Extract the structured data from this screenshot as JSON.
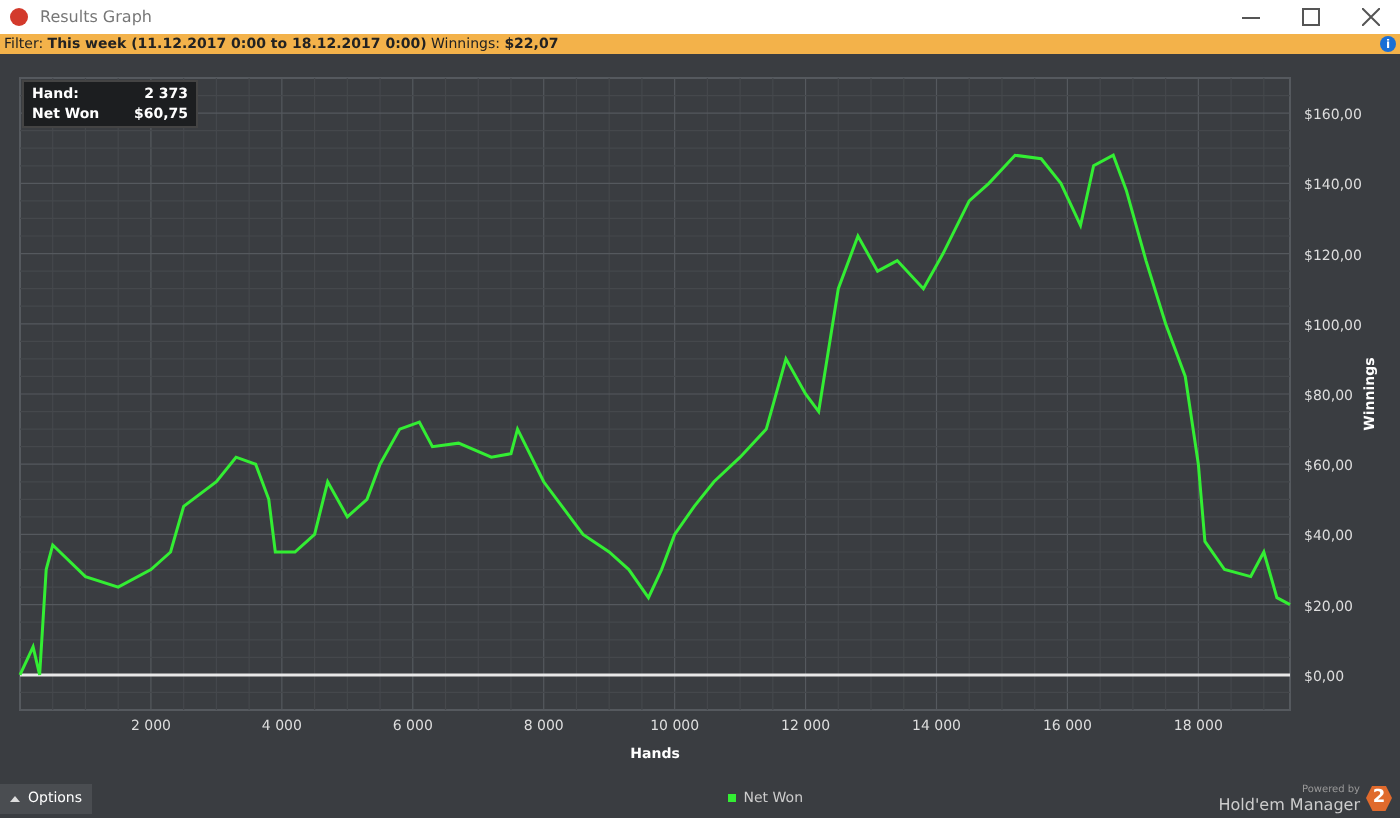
{
  "window": {
    "title": "Results Graph"
  },
  "filter_bar": {
    "text": "Filter: **This week (11.12.2017 0:00 to 18.12.2017 0:00)** Winnings: **$22,07**",
    "info": "i"
  },
  "hover_info": [
    {
      "label": "Hand:",
      "value": "2 373"
    },
    {
      "label": "Net Won",
      "value": "$60,75"
    }
  ],
  "chart_data": {
    "type": "line",
    "grid": true,
    "xlabel": "Hands",
    "ylabel": "Winnings",
    "xlim": [
      0,
      19400
    ],
    "ylim": [
      -10,
      170
    ],
    "xticks": [
      {
        "value": 2000,
        "label": "2 000"
      },
      {
        "value": 4000,
        "label": "4 000"
      },
      {
        "value": 6000,
        "label": "6 000"
      },
      {
        "value": 8000,
        "label": "8 000"
      },
      {
        "value": 10000,
        "label": "10 000"
      },
      {
        "value": 12000,
        "label": "12 000"
      },
      {
        "value": 14000,
        "label": "14 000"
      },
      {
        "value": 16000,
        "label": "16 000"
      },
      {
        "value": 18000,
        "label": "18 000"
      }
    ],
    "yticks": [
      {
        "value": 0,
        "label": "$0,00"
      },
      {
        "value": 20,
        "label": "$20,00"
      },
      {
        "value": 40,
        "label": "$40,00"
      },
      {
        "value": 60,
        "label": "$60,00"
      },
      {
        "value": 80,
        "label": "$80,00"
      },
      {
        "value": 100,
        "label": "$100,00"
      },
      {
        "value": 120,
        "label": "$120,00"
      },
      {
        "value": 140,
        "label": "$140,00"
      },
      {
        "value": 160,
        "label": "$160,00"
      }
    ],
    "x": [
      0,
      200,
      300,
      400,
      500,
      1000,
      1500,
      2000,
      2300,
      2500,
      3000,
      3300,
      3600,
      3800,
      3900,
      4200,
      4500,
      4700,
      5000,
      5300,
      5500,
      5800,
      6100,
      6300,
      6700,
      7200,
      7500,
      7600,
      8000,
      8200,
      8600,
      9000,
      9300,
      9600,
      9800,
      10000,
      10300,
      10600,
      11000,
      11400,
      11700,
      12000,
      12200,
      12500,
      12800,
      13100,
      13400,
      13800,
      14100,
      14500,
      14800,
      15200,
      15600,
      15900,
      16200,
      16400,
      16700,
      16900,
      17200,
      17500,
      17800,
      18000,
      18100,
      18400,
      18800,
      19000,
      19200,
      19400
    ],
    "series": [
      {
        "name": "Net Won",
        "color": "#33ee33",
        "values": [
          0,
          8,
          0,
          30,
          37,
          28,
          25,
          30,
          35,
          48,
          55,
          62,
          60,
          50,
          35,
          35,
          40,
          55,
          45,
          50,
          60,
          70,
          72,
          65,
          66,
          62,
          63,
          70,
          55,
          50,
          40,
          35,
          30,
          22,
          30,
          40,
          48,
          55,
          62,
          70,
          90,
          80,
          75,
          110,
          125,
          115,
          118,
          110,
          120,
          135,
          140,
          148,
          147,
          140,
          128,
          145,
          148,
          138,
          118,
          100,
          85,
          60,
          38,
          30,
          28,
          35,
          22,
          20
        ]
      }
    ]
  },
  "options_button": {
    "label": "Options"
  },
  "branding": {
    "powered_by": "Powered by",
    "product": "Hold'em Manager",
    "badge": "2"
  }
}
